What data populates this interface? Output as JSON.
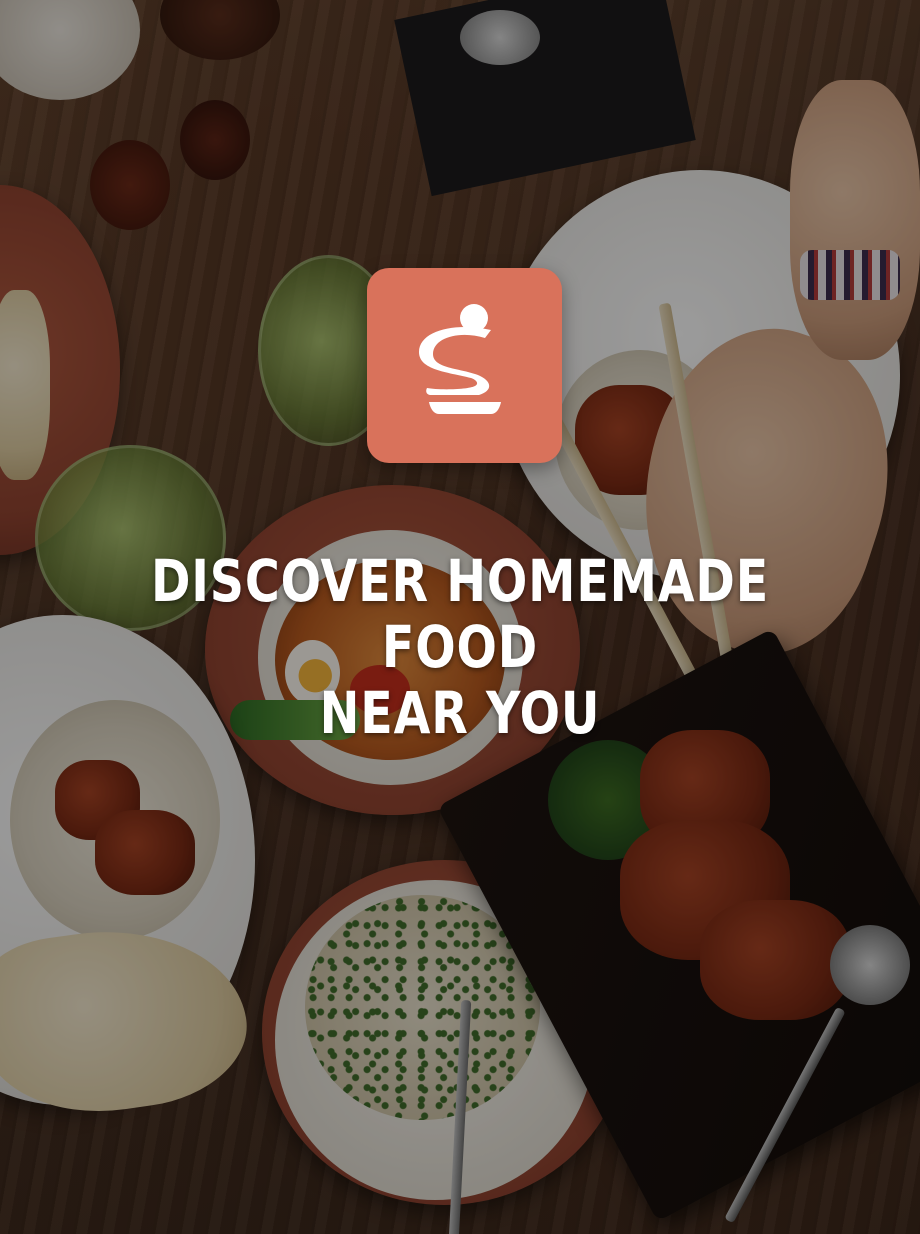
{
  "app": {
    "logo_icon": "stacked-dessert-s-icon",
    "logo_bg_color": "#d9725b",
    "logo_fg_color": "#ffffff"
  },
  "hero": {
    "headline_line1": "DISCOVER HOMEMADE FOOD",
    "headline_line2": "NEAR YOU",
    "headline_color": "#ffffff",
    "background_image": "overhead-table-with-dishes-photo"
  }
}
